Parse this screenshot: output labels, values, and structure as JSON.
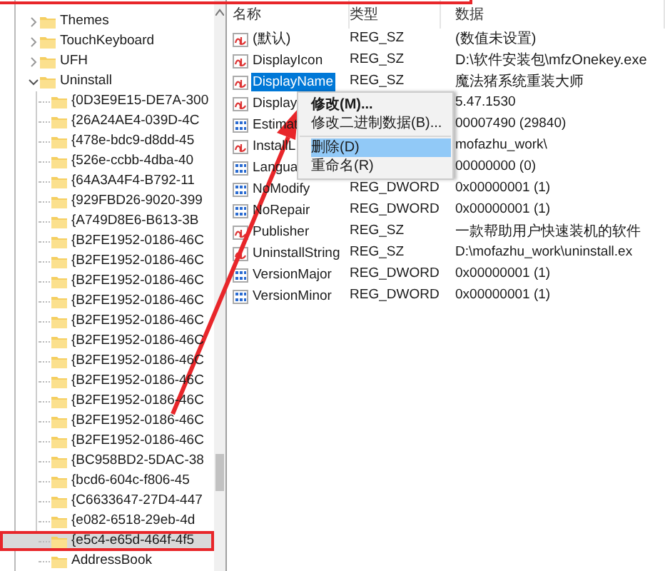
{
  "tree": {
    "items": [
      {
        "label": "Themes",
        "expanded": false,
        "selected": false
      },
      {
        "label": "TouchKeyboard",
        "expanded": false,
        "selected": false
      },
      {
        "label": "UFH",
        "expanded": false,
        "selected": false
      },
      {
        "label": "Uninstall",
        "expanded": true,
        "selected": false,
        "children": [
          {
            "label": "{0D3E9E15-DE7A-300",
            "selected": false
          },
          {
            "label": "{26A24AE4-039D-4C",
            "selected": false
          },
          {
            "label": "{478e-bdc9-d8dd-45",
            "selected": false
          },
          {
            "label": "{526e-ccbb-4dba-40",
            "selected": false
          },
          {
            "label": "{64A3A4F4-B792-11",
            "selected": false
          },
          {
            "label": "{929FBD26-9020-399",
            "selected": false
          },
          {
            "label": "{A749D8E6-B613-3B",
            "selected": false
          },
          {
            "label": "{B2FE1952-0186-46C",
            "selected": false
          },
          {
            "label": "{B2FE1952-0186-46C",
            "selected": false
          },
          {
            "label": "{B2FE1952-0186-46C",
            "selected": false
          },
          {
            "label": "{B2FE1952-0186-46C",
            "selected": false
          },
          {
            "label": "{B2FE1952-0186-46C",
            "selected": false
          },
          {
            "label": "{B2FE1952-0186-46C",
            "selected": false
          },
          {
            "label": "{B2FE1952-0186-46C",
            "selected": false
          },
          {
            "label": "{B2FE1952-0186-46C",
            "selected": false
          },
          {
            "label": "{B2FE1952-0186-46C",
            "selected": false
          },
          {
            "label": "{B2FE1952-0186-46C",
            "selected": false
          },
          {
            "label": "{B2FE1952-0186-46C",
            "selected": false
          },
          {
            "label": "{BC958BD2-5DAC-38",
            "selected": false
          },
          {
            "label": "{bcd6-604c-f806-45",
            "selected": false
          },
          {
            "label": "{C6633647-27D4-447",
            "selected": false
          },
          {
            "label": "{e082-6518-29eb-4d",
            "selected": false
          },
          {
            "label": "{e5c4-e65d-464f-4f5",
            "selected": true
          },
          {
            "label": "AddressBook",
            "selected": false
          }
        ]
      }
    ]
  },
  "values": {
    "columns": [
      "名称",
      "类型",
      "数据"
    ],
    "rows": [
      {
        "kind": "sz",
        "name": "(默认)",
        "type": "REG_SZ",
        "data": "(数值未设置)",
        "selected": false
      },
      {
        "kind": "sz",
        "name": "DisplayIcon",
        "type": "REG_SZ",
        "data": "D:\\软件安装包\\mfzOnekey.exe",
        "selected": false
      },
      {
        "kind": "sz",
        "name": "DisplayName",
        "type": "REG_SZ",
        "data": "魔法猪系统重装大师",
        "selected": true
      },
      {
        "kind": "sz",
        "name": "Display",
        "data": "5.47.1530",
        "selected": false
      },
      {
        "kind": "dword",
        "name": "Estimat",
        "data": "00007490 (29840)",
        "selected": false
      },
      {
        "kind": "sz",
        "name": "InstallL",
        "data": "mofazhu_work\\",
        "selected": false
      },
      {
        "kind": "dword",
        "name": "Langua",
        "data": "00000000 (0)",
        "selected": false
      },
      {
        "kind": "dword",
        "name": "NoModify",
        "type": "REG_DWORD",
        "data": "0x00000001 (1)",
        "selected": false
      },
      {
        "kind": "dword",
        "name": "NoRepair",
        "type": "REG_DWORD",
        "data": "0x00000001 (1)",
        "selected": false
      },
      {
        "kind": "sz",
        "name": "Publisher",
        "type": "REG_SZ",
        "data": "一款帮助用户快速装机的软件",
        "selected": false
      },
      {
        "kind": "sz",
        "name": "UninstallString",
        "type": "REG_SZ",
        "data": "D:\\mofazhu_work\\uninstall.ex",
        "selected": false
      },
      {
        "kind": "dword",
        "name": "VersionMajor",
        "type": "REG_DWORD",
        "data": "0x00000001 (1)",
        "selected": false
      },
      {
        "kind": "dword",
        "name": "VersionMinor",
        "type": "REG_DWORD",
        "data": "0x00000001 (1)",
        "selected": false
      }
    ]
  },
  "context_menu": {
    "items": [
      {
        "label": "修改(M)...",
        "default": true,
        "separator_before": false,
        "selected": false
      },
      {
        "label": "修改二进制数据(B)...",
        "default": false,
        "separator_before": false,
        "selected": false
      },
      {
        "label": "删除(D)",
        "default": false,
        "separator_before": true,
        "selected": true
      },
      {
        "label": "重命名(R)",
        "default": false,
        "separator_before": false,
        "selected": false
      }
    ]
  }
}
